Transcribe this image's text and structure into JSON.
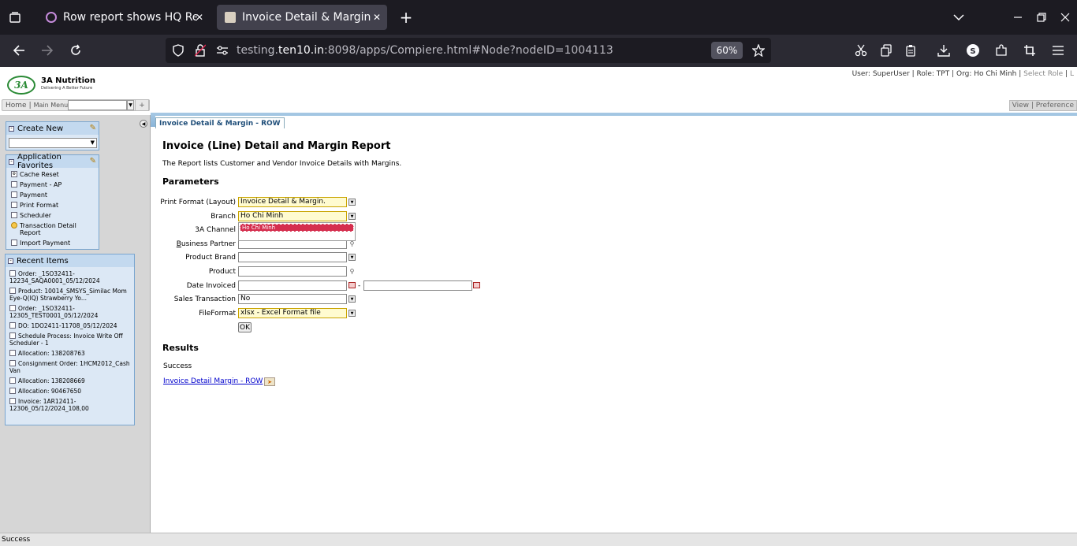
{
  "browser": {
    "tabs": [
      {
        "title": "Row report shows HQ Re",
        "active": false
      },
      {
        "title": "Invoice Detail & Margin -",
        "active": true
      }
    ],
    "url_prefix": "testing.",
    "url_host": "ten10.in",
    "url_rest": ":8098/apps/Compiere.html#Node?nodeID=1004113",
    "zoom": "60%",
    "icons": [
      "tab-overview-icon",
      "new-tab-icon",
      "list-tabs-icon",
      "minimize-icon",
      "restore-icon",
      "close-icon",
      "back-icon",
      "forward-icon",
      "reload-icon",
      "shield-icon",
      "lock-icon",
      "site-settings-icon",
      "bookmark-star-icon",
      "cut-icon",
      "copy-icon",
      "paste-icon",
      "download-icon",
      "account-icon",
      "extensions-icon",
      "crop-icon",
      "menu-icon"
    ]
  },
  "header": {
    "logo_mark": "3A",
    "brand_name": "3A Nutrition",
    "brand_tagline": "Delivering A Better Future",
    "user": "User: SuperUser",
    "role": "Role: TPT",
    "org": "Org: Ho Chi Minh",
    "select_role": "Select Role",
    "trailing": "L",
    "home": "Home",
    "main_menu": "Main Menu",
    "add": "+",
    "view_pref": "View | Preference"
  },
  "left": {
    "create_new_title": "Create New",
    "favorites_title": "Application Favorites",
    "favorites": [
      {
        "label": "Cache Reset",
        "icon": "gear"
      },
      {
        "label": "Payment - AP",
        "icon": "window"
      },
      {
        "label": "Payment",
        "icon": "window"
      },
      {
        "label": "Print Format",
        "icon": "window"
      },
      {
        "label": "Scheduler",
        "icon": "window"
      },
      {
        "label": "Transaction Detail Report",
        "icon": "report"
      },
      {
        "label": "Import Payment",
        "icon": "window"
      }
    ],
    "recent_title": "Recent Items",
    "recent": [
      "Order: _1SO32411-12234_SAQA0001_05/12/2024",
      "Product: 10014_SMSYS_Similac Mom Eye-Q(IQ) Strawberry Yo...",
      "Order: _1SO32411-12305_TEST0001_05/12/2024",
      "DO: 1DO2411-11708_05/12/2024",
      "Schedule Process: Invoice Write Off Scheduler - 1",
      "Allocation: 138208763",
      "Consignment Order: 1HCM2012_Cash Van",
      "Allocation: 138208669",
      "Allocation: 90467650",
      "Invoice: 1AR12411-12306_05/12/2024_108,00"
    ]
  },
  "main": {
    "tab_label": "Invoice Detail & Margin - ROW",
    "title": "Invoice (Line) Detail and Margin Report",
    "description": "The Report lists Customer and Vendor Invoice Details with Margins.",
    "parameters_header": "Parameters",
    "params": {
      "print_format_label": "Print Format (Layout)",
      "print_format_value": "Invoice Detail & Margin.",
      "branch_label": "Branch",
      "branch_value": "Ho Chi Minh",
      "channel_label": "3A Channel",
      "channel_popup_option": "Ho Chi Minh",
      "bp_label_rest": "usiness Partner",
      "bp_label_first": "B",
      "product_brand_label": "Product Brand",
      "product_label": "Product",
      "date_invoiced_label": "Date Invoiced",
      "date_sep": "-",
      "sales_trx_label": "Sales Transaction",
      "sales_trx_value": "No",
      "file_format_label": "FileFormat",
      "file_format_value": "xlsx - Excel Format file"
    },
    "ok_label": "OK",
    "results_header": "Results",
    "result_status": "Success",
    "result_link": "Invoice Detail  Margin - ROW"
  },
  "status_bar": "Success"
}
